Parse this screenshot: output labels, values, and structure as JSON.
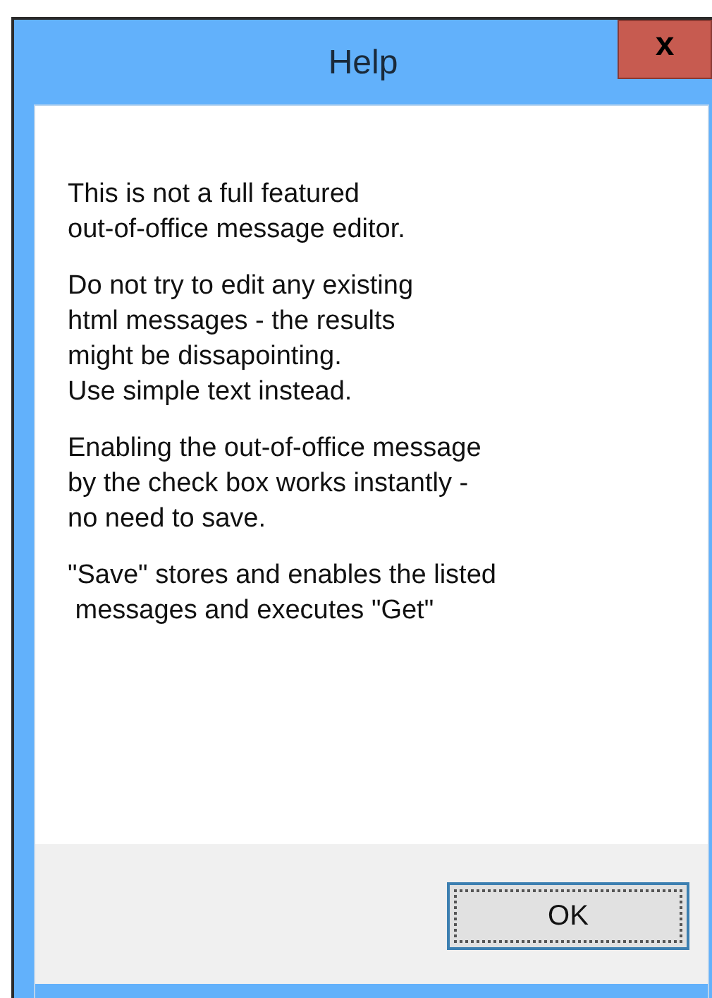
{
  "window": {
    "title": "Help",
    "close": "x"
  },
  "paragraphs": [
    [
      "This is not a full featured",
      "out-of-office message editor."
    ],
    [
      "Do not try to edit any existing",
      "html messages - the results",
      "might be dissapointing.",
      "Use simple text instead."
    ],
    [
      "Enabling the out-of-office message",
      "by the check box works instantly -",
      "no need to save."
    ],
    [
      "\"Save\" stores and enables the listed",
      " messages and executes \"Get\""
    ]
  ],
  "buttons": [
    {
      "label": "OK",
      "focused": true
    }
  ]
}
